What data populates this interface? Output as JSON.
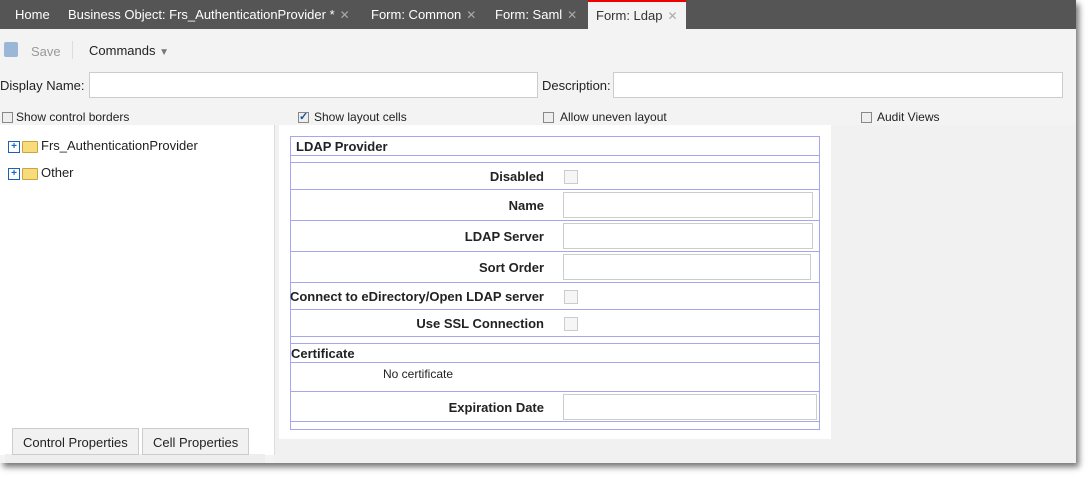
{
  "tabs": [
    {
      "label": "Home"
    },
    {
      "label": "Business Object: Frs_AuthenticationProvider *"
    },
    {
      "label": "Form: Common"
    },
    {
      "label": "Form: Saml"
    },
    {
      "label": "Form: Ldap"
    }
  ],
  "close_glyph": "✕",
  "toolbar": {
    "save_label": "Save",
    "commands_label": "Commands"
  },
  "fields": {
    "display_name_label": "Display Name:",
    "display_name_value": "",
    "description_label": "Description:",
    "description_value": ""
  },
  "options": [
    {
      "label": "Show control borders",
      "checked": false
    },
    {
      "label": "Show layout cells",
      "checked": true
    },
    {
      "label": "Allow uneven layout",
      "checked": false
    },
    {
      "label": "Audit Views",
      "checked": false
    }
  ],
  "tree": [
    {
      "label": "Frs_AuthenticationProvider"
    },
    {
      "label": "Other"
    }
  ],
  "bottom_tabs": {
    "control": "Control Properties",
    "cell": "Cell Properties"
  },
  "form": {
    "title": "LDAP Provider",
    "disabled": "Disabled",
    "name": "Name",
    "ldap_server": "LDAP Server",
    "sort_order": "Sort Order",
    "connect": "Connect to eDirectory/Open LDAP server",
    "ssl": "Use SSL Connection",
    "certificate": "Certificate",
    "no_certificate": "No certificate",
    "expiration": "Expiration Date"
  }
}
